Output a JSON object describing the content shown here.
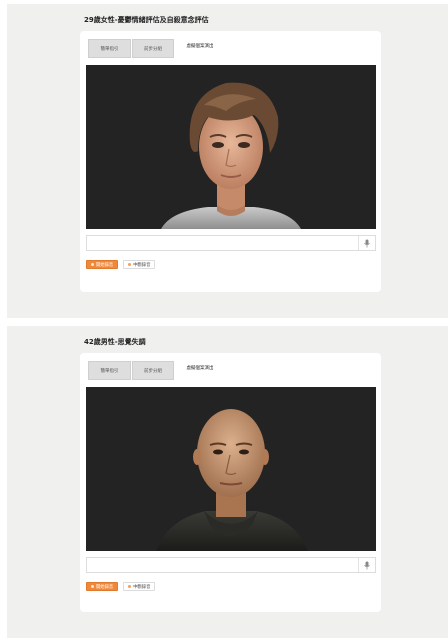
{
  "cases": [
    {
      "title": "29歲女性-憂鬱情緒評估及自殺意念評估",
      "tabs": [
        "簡單指引",
        "前步分組",
        "虛擬個案演出"
      ],
      "input_placeholder": "",
      "buttons": {
        "primary": "開始錄音",
        "secondary": "中斷錄音"
      },
      "avatar": "female-patient-avatar"
    },
    {
      "title": "42歲男性-思覺失調",
      "tabs": [
        "簡單指引",
        "前步分組",
        "虛擬個案演出"
      ],
      "input_placeholder": "",
      "buttons": {
        "primary": "開始錄音",
        "secondary": "中斷錄音"
      },
      "avatar": "male-patient-avatar"
    }
  ],
  "icons": {
    "mic": "microphone-icon"
  },
  "colors": {
    "accent": "#f0883a",
    "video_bg": "#232323",
    "panel_bg": "#f0f0ef"
  }
}
